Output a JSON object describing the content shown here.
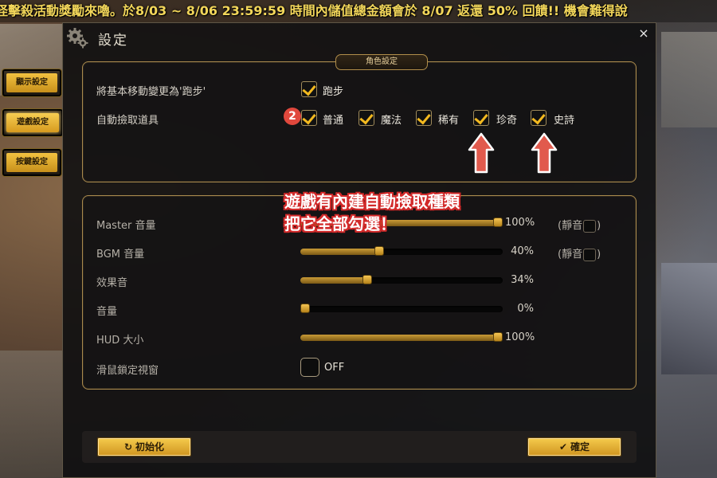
{
  "marquee": {
    "text": "怪擊殺活動獎勵來嚕。於8/03 ~ 8/06 23:59:59 時間內儲值總金額會於 8/07 返還 50% 回饋!! 機會難得說"
  },
  "side_tabs": [
    {
      "label": "顯示設定",
      "active": false
    },
    {
      "label": "遊戲設定",
      "active": true
    },
    {
      "label": "按鍵設定",
      "active": false
    }
  ],
  "window": {
    "title": "設定",
    "close_glyph": "×"
  },
  "character_section": {
    "header": "角色設定",
    "walk_row": {
      "label": "將基本移動變更為'跑步'",
      "option": {
        "label": "跑步",
        "checked": true
      }
    },
    "loot_row": {
      "label": "自動撿取道具",
      "badge": "2",
      "options": [
        {
          "label": "普通",
          "checked": true
        },
        {
          "label": "魔法",
          "checked": true
        },
        {
          "label": "稀有",
          "checked": true
        },
        {
          "label": "珍奇",
          "checked": true
        },
        {
          "label": "史詩",
          "checked": true
        }
      ]
    }
  },
  "sound_section": {
    "sliders": [
      {
        "label": "Master 音量",
        "value": 100,
        "display": "100%",
        "mute": {
          "label_open": "(靜音",
          "label_close": ")",
          "checked": false
        }
      },
      {
        "label": "BGM 音量",
        "value": 40,
        "display": "40%",
        "mute": {
          "label_open": "(靜音",
          "label_close": ")",
          "checked": false
        }
      },
      {
        "label": "效果音",
        "value": 34,
        "display": "34%"
      },
      {
        "label": "音量",
        "value": 0,
        "display": "0%"
      },
      {
        "label": "HUD 大小",
        "value": 100,
        "display": "100%"
      }
    ],
    "mouse_lock": {
      "label": "滑鼠鎖定視窗",
      "state": "OFF",
      "checked": false
    }
  },
  "annotation": {
    "line1": "遊戲有內建自動撿取種類",
    "line2": "把它全部勾選！"
  },
  "footer": {
    "reset_label": "初始化",
    "reset_icon": "↻",
    "confirm_label": "確定",
    "confirm_icon": "✔"
  },
  "colors": {
    "accent_gold": "#f3b91f",
    "annotation_red": "#d22a2a",
    "badge_red": "#e0483d"
  }
}
